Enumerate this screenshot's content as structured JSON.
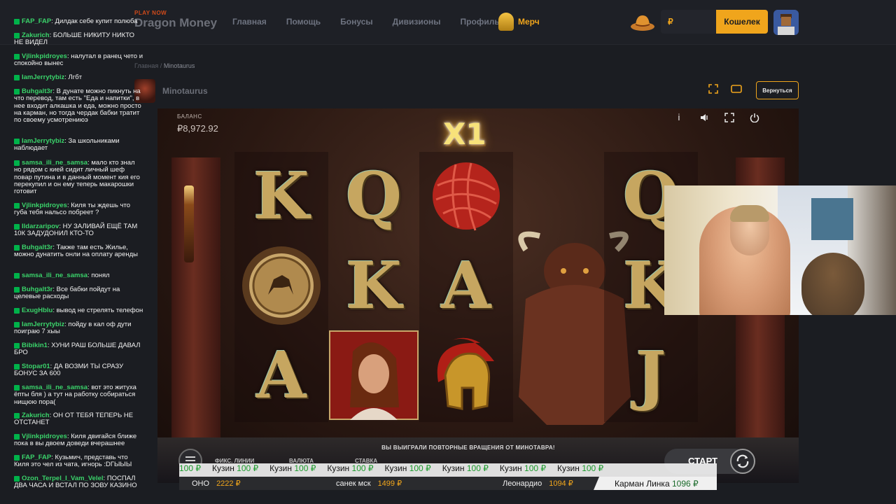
{
  "nav": {
    "brand_small": "PLAY NOW",
    "brand": "Dragon Money",
    "links": [
      "Главная",
      "Помощь",
      "Бонусы",
      "Дивизионы",
      "Профиль"
    ],
    "merch": "Мерч",
    "balance_currency": "₽",
    "wallet": "Кошелек"
  },
  "breadcrumb": {
    "home": "Главная",
    "sep": "/",
    "current": "Minotaurus"
  },
  "game_header": {
    "title": "Minotaurus",
    "back": "Вернуться"
  },
  "game": {
    "balance_label": "БАЛАНС",
    "balance_value": "₽8,972.92",
    "multiplier": "X1",
    "win_message": "ВЫ ВЫИГРАЛИ ПОВТОРНЫЕ ВРАЩЕНИЯ ОТ МИНОТАВРА!",
    "labels": [
      "ФИКС. ЛИНИИ",
      "ВАЛЮТА",
      "СТАВКА"
    ],
    "start": "СТАРТ",
    "reels": [
      [
        "K",
        "shield-symbol",
        "A"
      ],
      [
        "Q",
        "K",
        "woman-symbol"
      ],
      [
        "yarn-symbol",
        "A",
        "helmet-symbol"
      ],
      [
        "",
        "",
        ""
      ],
      [
        "Q",
        "K",
        "J"
      ]
    ]
  },
  "ticker1": [
    {
      "name": "",
      "amount": "100 ₽"
    },
    {
      "name": "Кузин",
      "amount": "100 ₽"
    },
    {
      "name": "Кузин",
      "amount": "100 ₽"
    },
    {
      "name": "Кузин",
      "amount": "100 ₽"
    },
    {
      "name": "Кузин",
      "amount": "100 ₽"
    },
    {
      "name": "Кузин",
      "amount": "100 ₽"
    },
    {
      "name": "Кузин",
      "amount": "100 ₽"
    },
    {
      "name": "Кузин",
      "amount": "100 ₽"
    }
  ],
  "ticker2": [
    {
      "name": "ОНО",
      "amount": "2222 ₽"
    },
    {
      "name": "санек мск",
      "amount": "1499 ₽"
    },
    {
      "name": "Леонардио",
      "amount": "1094 ₽"
    },
    {
      "name": "Карман Линка",
      "amount": "1096 ₽"
    }
  ],
  "chat": [
    {
      "user": "FAP_FAP",
      "text": "Дилдак себе купит полюба"
    },
    {
      "user": "Zakurich",
      "text": "БОЛЬШЕ НИКИТУ НИКТО НЕ ВИДЕЛ"
    },
    {
      "user": "Vjlinkpidroyes",
      "text": "налутал в ранец чето и спокойно вынес"
    },
    {
      "user": "IamJerrytybiz",
      "text": "Лгбт"
    },
    {
      "user": "Buhgalt3r",
      "text": "В дунате можно пикнуть на что перевод, там есть \"Еда и напитки\", в нее входит алкашка и еда, можно просто на карман, но тогда чердак бабки тратит по своему усмотрениюэ"
    },
    {
      "user": "IamJerrytybiz",
      "text": "За школьниками наблюдает"
    },
    {
      "user": "samsa_ili_ne_samsa",
      "text": "мало кто знал но рядом с кией сидит личный шеф повар путина и в данный момент кия его перекупил и он ему теперь макарошки готовит"
    },
    {
      "user": "Vjlinkpidroyes",
      "text": "Киля ты ждешь что губа тебя нальсо побреет ?"
    },
    {
      "user": "Ildarzaripov",
      "text": "НУ ЗАЛИВАЙ ЕЩЁ ТАМ 10К ЗАДУДОНИЛ КТО-ТО"
    },
    {
      "user": "Buhgalt3r",
      "text": "Также там есть Жилье, можно дунатить онли на оплату аренды"
    },
    {
      "user": "samsa_ili_ne_samsa",
      "text": "понял"
    },
    {
      "user": "Buhgalt3r",
      "text": "Все бабки пойдут на целевые расходы"
    },
    {
      "user": "ExugHblu",
      "text": "вывод не стрелять телефон"
    },
    {
      "user": "IamJerrytybiz",
      "text": "пойду в кал оф дути поиграю 7 хыы"
    },
    {
      "user": "Bibikin1",
      "text": "ХУНИ РАШ БОЛЬШЕ ДАВАЛ БРО"
    },
    {
      "user": "Stopar01",
      "text": "ДА ВОЗМИ ТЫ СРАЗУ БОНУС ЗА 600"
    },
    {
      "user": "samsa_ili_ne_samsa",
      "text": "вот это житуха ёпты бля ) а тут на работку собираться нищюю пора("
    },
    {
      "user": "Zakurich",
      "text": "ОН ОТ ТЕБЯ ТЕПЕРЬ НЕ ОТСТАНЕТ"
    },
    {
      "user": "Vjlinkpidroyes",
      "text": "Киля двигайся ближе пока в вы двоем доведи вчерашнее"
    },
    {
      "user": "FAP_FAP",
      "text": "Кузьмич, представь что Киля это чел из чата, игнорь :DГЫЫЫ"
    },
    {
      "user": "Ozon_Terpel_I_Vam_Velel",
      "text": "ПОСПАЛ ДВА ЧАСА И ВСТАЛ ПО ЗОВУ КАЗИНО"
    }
  ]
}
